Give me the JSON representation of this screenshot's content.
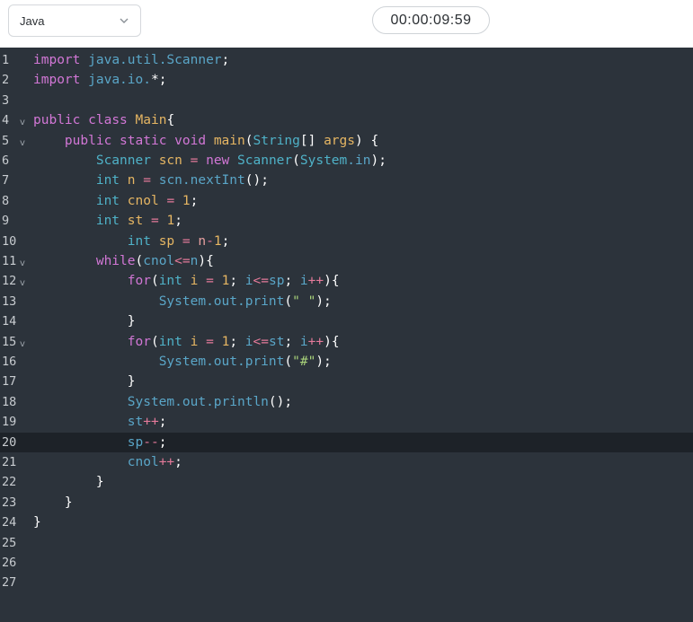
{
  "toolbar": {
    "language": "Java",
    "timer": "00:00:09:59"
  },
  "editor": {
    "active_line": 20,
    "lines": [
      {
        "n": "1",
        "fold": false,
        "tokens": [
          [
            "kw",
            "import"
          ],
          [
            "op",
            " "
          ],
          [
            "pkg",
            "java.util.Scanner"
          ],
          [
            "pun",
            ";"
          ]
        ]
      },
      {
        "n": "2",
        "fold": false,
        "tokens": [
          [
            "kw",
            "import"
          ],
          [
            "op",
            " "
          ],
          [
            "pkg",
            "java.io."
          ],
          [
            "pun",
            "*;"
          ]
        ]
      },
      {
        "n": "3",
        "fold": false,
        "tokens": []
      },
      {
        "n": "4",
        "fold": true,
        "tokens": [
          [
            "kw",
            "public"
          ],
          [
            "op",
            " "
          ],
          [
            "kw",
            "class"
          ],
          [
            "op",
            " "
          ],
          [
            "cls",
            "Main"
          ],
          [
            "pun",
            "{"
          ]
        ]
      },
      {
        "n": "5",
        "fold": true,
        "tokens": [
          [
            "op",
            "    "
          ],
          [
            "kw",
            "public"
          ],
          [
            "op",
            " "
          ],
          [
            "kw",
            "static"
          ],
          [
            "op",
            " "
          ],
          [
            "kw",
            "void"
          ],
          [
            "op",
            " "
          ],
          [
            "cls",
            "main"
          ],
          [
            "pun",
            "("
          ],
          [
            "type",
            "String"
          ],
          [
            "pun",
            "[] "
          ],
          [
            "cls",
            "args"
          ],
          [
            "pun",
            ") {"
          ]
        ]
      },
      {
        "n": "6",
        "fold": false,
        "tokens": [
          [
            "op",
            "        "
          ],
          [
            "type",
            "Scanner"
          ],
          [
            "op",
            " "
          ],
          [
            "cls",
            "scn"
          ],
          [
            "op",
            " "
          ],
          [
            "opc",
            "="
          ],
          [
            "op",
            " "
          ],
          [
            "kw",
            "new"
          ],
          [
            "op",
            " "
          ],
          [
            "type",
            "Scanner"
          ],
          [
            "pun",
            "("
          ],
          [
            "type",
            "System"
          ],
          [
            "pkg",
            ".in"
          ],
          [
            "pun",
            ");"
          ]
        ]
      },
      {
        "n": "7",
        "fold": false,
        "tokens": [
          [
            "op",
            "        "
          ],
          [
            "type",
            "int"
          ],
          [
            "op",
            " "
          ],
          [
            "cls",
            "n"
          ],
          [
            "op",
            " "
          ],
          [
            "opc",
            "="
          ],
          [
            "op",
            " "
          ],
          [
            "pkg",
            "scn.nextInt"
          ],
          [
            "pun",
            "();"
          ]
        ]
      },
      {
        "n": "8",
        "fold": false,
        "tokens": [
          [
            "op",
            "        "
          ],
          [
            "type",
            "int"
          ],
          [
            "op",
            " "
          ],
          [
            "cls",
            "cnol"
          ],
          [
            "op",
            " "
          ],
          [
            "opc",
            "="
          ],
          [
            "op",
            " "
          ],
          [
            "num",
            "1"
          ],
          [
            "pun",
            ";"
          ]
        ]
      },
      {
        "n": "9",
        "fold": false,
        "tokens": [
          [
            "op",
            "        "
          ],
          [
            "type",
            "int"
          ],
          [
            "op",
            " "
          ],
          [
            "cls",
            "st"
          ],
          [
            "op",
            " "
          ],
          [
            "opc",
            "="
          ],
          [
            "op",
            " "
          ],
          [
            "num",
            "1"
          ],
          [
            "pun",
            ";"
          ]
        ]
      },
      {
        "n": "10",
        "fold": false,
        "tokens": [
          [
            "op",
            "            "
          ],
          [
            "type",
            "int"
          ],
          [
            "op",
            " "
          ],
          [
            "cls",
            "sp"
          ],
          [
            "op",
            " "
          ],
          [
            "opc",
            "="
          ],
          [
            "op",
            " "
          ],
          [
            "var",
            "n"
          ],
          [
            "opc",
            "-"
          ],
          [
            "num",
            "1"
          ],
          [
            "pun",
            ";"
          ]
        ]
      },
      {
        "n": "11",
        "fold": true,
        "tokens": [
          [
            "op",
            "        "
          ],
          [
            "kw",
            "while"
          ],
          [
            "pun",
            "("
          ],
          [
            "pkg",
            "cnol"
          ],
          [
            "opc",
            "<="
          ],
          [
            "pkg",
            "n"
          ],
          [
            "pun",
            "){"
          ]
        ]
      },
      {
        "n": "12",
        "fold": true,
        "tokens": [
          [
            "op",
            "            "
          ],
          [
            "kw",
            "for"
          ],
          [
            "pun",
            "("
          ],
          [
            "type",
            "int"
          ],
          [
            "op",
            " "
          ],
          [
            "cls",
            "i"
          ],
          [
            "op",
            " "
          ],
          [
            "opc",
            "="
          ],
          [
            "op",
            " "
          ],
          [
            "num",
            "1"
          ],
          [
            "pun",
            "; "
          ],
          [
            "pkg",
            "i"
          ],
          [
            "opc",
            "<="
          ],
          [
            "pkg",
            "sp"
          ],
          [
            "pun",
            "; "
          ],
          [
            "pkg",
            "i"
          ],
          [
            "opc",
            "++"
          ],
          [
            "pun",
            "){"
          ]
        ]
      },
      {
        "n": "13",
        "fold": false,
        "tokens": [
          [
            "op",
            "                "
          ],
          [
            "pkg",
            "System.out.print"
          ],
          [
            "pun",
            "("
          ],
          [
            "str",
            "\" \""
          ],
          [
            "pun",
            ");"
          ]
        ]
      },
      {
        "n": "14",
        "fold": false,
        "tokens": [
          [
            "op",
            "            "
          ],
          [
            "pun",
            "}"
          ]
        ]
      },
      {
        "n": "15",
        "fold": true,
        "tokens": [
          [
            "op",
            "            "
          ],
          [
            "kw",
            "for"
          ],
          [
            "pun",
            "("
          ],
          [
            "type",
            "int"
          ],
          [
            "op",
            " "
          ],
          [
            "cls",
            "i"
          ],
          [
            "op",
            " "
          ],
          [
            "opc",
            "="
          ],
          [
            "op",
            " "
          ],
          [
            "num",
            "1"
          ],
          [
            "pun",
            "; "
          ],
          [
            "pkg",
            "i"
          ],
          [
            "opc",
            "<="
          ],
          [
            "pkg",
            "st"
          ],
          [
            "pun",
            "; "
          ],
          [
            "pkg",
            "i"
          ],
          [
            "opc",
            "++"
          ],
          [
            "pun",
            "){"
          ]
        ]
      },
      {
        "n": "16",
        "fold": false,
        "tokens": [
          [
            "op",
            "                "
          ],
          [
            "pkg",
            "System.out.print"
          ],
          [
            "pun",
            "("
          ],
          [
            "str",
            "\"#\""
          ],
          [
            "pun",
            ");"
          ]
        ]
      },
      {
        "n": "17",
        "fold": false,
        "tokens": [
          [
            "op",
            "            "
          ],
          [
            "pun",
            "}"
          ]
        ]
      },
      {
        "n": "18",
        "fold": false,
        "tokens": [
          [
            "op",
            "            "
          ],
          [
            "pkg",
            "System.out.println"
          ],
          [
            "pun",
            "();"
          ]
        ]
      },
      {
        "n": "19",
        "fold": false,
        "tokens": [
          [
            "op",
            "            "
          ],
          [
            "pkg",
            "st"
          ],
          [
            "opc",
            "++"
          ],
          [
            "pun",
            ";"
          ]
        ]
      },
      {
        "n": "20",
        "fold": false,
        "tokens": [
          [
            "op",
            "            "
          ],
          [
            "pkg",
            "sp"
          ],
          [
            "opc",
            "--"
          ],
          [
            "pun",
            ";"
          ]
        ]
      },
      {
        "n": "21",
        "fold": false,
        "tokens": [
          [
            "op",
            "            "
          ],
          [
            "pkg",
            "cnol"
          ],
          [
            "opc",
            "++"
          ],
          [
            "pun",
            ";"
          ]
        ]
      },
      {
        "n": "22",
        "fold": false,
        "tokens": [
          [
            "op",
            "        "
          ],
          [
            "pun",
            "}"
          ]
        ]
      },
      {
        "n": "23",
        "fold": false,
        "tokens": [
          [
            "op",
            "    "
          ],
          [
            "pun",
            "}"
          ]
        ]
      },
      {
        "n": "24",
        "fold": false,
        "tokens": [
          [
            "pun",
            "}"
          ]
        ]
      },
      {
        "n": "25",
        "fold": false,
        "tokens": []
      },
      {
        "n": "26",
        "fold": false,
        "tokens": []
      },
      {
        "n": "27",
        "fold": false,
        "tokens": []
      }
    ]
  }
}
